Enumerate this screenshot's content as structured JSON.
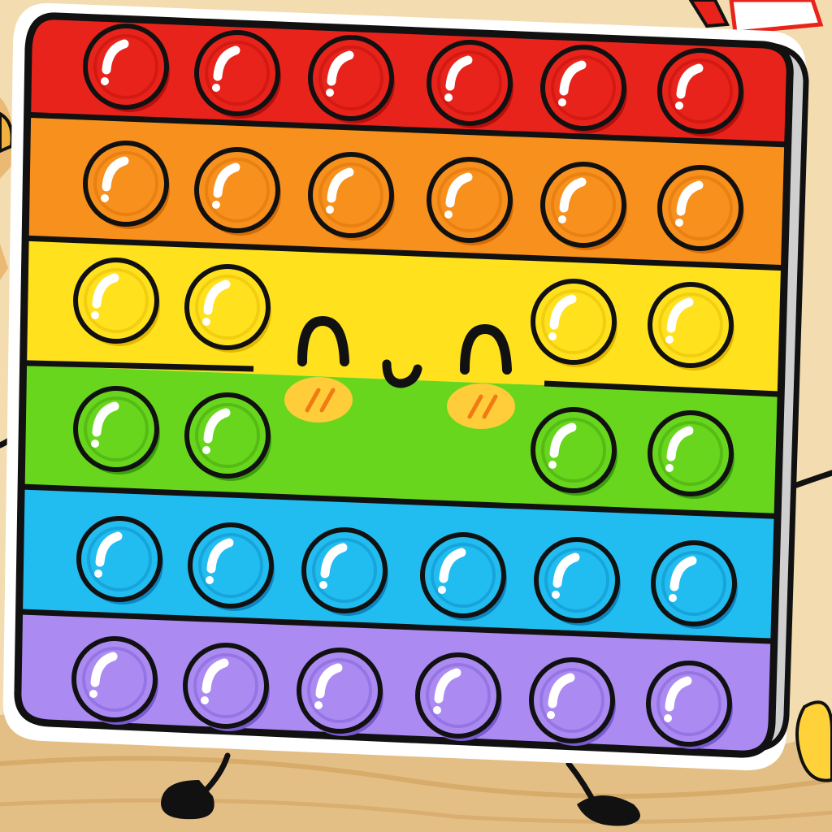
{
  "game": {
    "name": "",
    "palette": {
      "background": "#ffffff",
      "wood": "#e9c78c",
      "wood_dark": "#c9974f",
      "outline": "#111111",
      "rows": [
        {
          "name": "red",
          "fill": "#e8231b",
          "dark": "#b80f0c",
          "light": "#ff6a5a"
        },
        {
          "name": "orange",
          "fill": "#f7901c",
          "dark": "#d66c06",
          "light": "#ffc070"
        },
        {
          "name": "yellow",
          "fill": "#ffe11e",
          "dark": "#e3b800",
          "light": "#fff38a"
        },
        {
          "name": "green",
          "fill": "#68d61c",
          "dark": "#3c9e0e",
          "light": "#b6f27a"
        },
        {
          "name": "blue",
          "fill": "#22bdf0",
          "dark": "#0b86c2",
          "light": "#95e4ff"
        },
        {
          "name": "purple",
          "fill": "#ab8bf2",
          "dark": "#7a5ad0",
          "light": "#d7c8ff"
        }
      ],
      "blush": "#ffcc3a",
      "blush_lines": "#f07a14"
    },
    "character": {
      "type": "pop-it fidget toy",
      "face": {
        "eyes": "closed-happy-arcs",
        "mouth": "small-w-smile",
        "cheeks": "blush"
      },
      "limbs": [
        "left-arm",
        "right-arm",
        "left-leg",
        "right-leg"
      ]
    },
    "board": {
      "rows": 6,
      "columns": 6,
      "bubble_rows": [
        {
          "color": "red",
          "columns": [
            1,
            2,
            3,
            4,
            5,
            6
          ]
        },
        {
          "color": "orange",
          "columns": [
            1,
            2,
            3,
            4,
            5,
            6
          ]
        },
        {
          "color": "yellow",
          "columns": [
            1,
            2,
            5,
            6
          ]
        },
        {
          "color": "green",
          "columns": [
            1,
            2,
            5,
            6
          ]
        },
        {
          "color": "blue",
          "columns": [
            1,
            2,
            3,
            4,
            5,
            6
          ]
        },
        {
          "color": "purple",
          "columns": [
            1,
            2,
            3,
            4,
            5,
            6
          ]
        }
      ],
      "popped_count": 0
    }
  }
}
